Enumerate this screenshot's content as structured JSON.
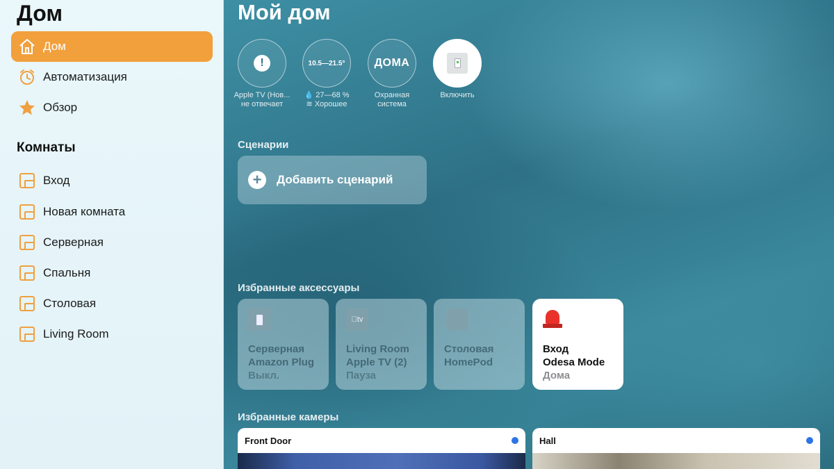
{
  "sidebar": {
    "title": "Дом",
    "nav": [
      {
        "label": "Дом",
        "icon": "house-icon",
        "active": true
      },
      {
        "label": "Автоматизация",
        "icon": "clock-icon",
        "active": false
      },
      {
        "label": "Обзор",
        "icon": "star-icon",
        "active": false
      }
    ],
    "rooms_title": "Комнаты",
    "rooms": [
      "Вход",
      "Новая комната",
      "Серверная",
      "Спальня",
      "Столовая",
      "Living Room"
    ]
  },
  "main": {
    "title": "Мой дом",
    "status": [
      {
        "icon": "alert-icon",
        "caption_line1": "Apple TV (Нов...",
        "caption_line2": "не отвечает"
      },
      {
        "value": "10.5—21.5°",
        "caption_line1": "💧 27—68 %",
        "caption_line2": "≋ Хорошее"
      },
      {
        "value": "ДОМА",
        "caption_line1": "Охранная",
        "caption_line2": "система"
      },
      {
        "icon": "plug-icon",
        "caption_line1": "Включить",
        "caption_line2": ""
      }
    ],
    "scenes_label": "Сценарии",
    "add_scene_label": "Добавить сценарий",
    "favorites_label": "Избранные аксессуары",
    "accessories": [
      {
        "name_line1": "Серверная",
        "name_line2": "Amazon Plug",
        "state": "Выкл.",
        "icon": "plug-icon",
        "on": false
      },
      {
        "name_line1": "Living Room",
        "name_line2": "Apple TV (2)",
        "state": "Пауза",
        "icon": "apple-tv-icon",
        "icon_text": "tv",
        "on": false
      },
      {
        "name_line1": "Столовая",
        "name_line2": "HomePod",
        "state": "",
        "icon": "homepod-icon",
        "on": false
      },
      {
        "name_line1": "Вход",
        "name_line2": "Odesa Mode",
        "state": "Дома",
        "icon": "siren-icon",
        "on": true
      }
    ],
    "cameras_label": "Избранные камеры",
    "cameras": [
      {
        "name": "Front Door"
      },
      {
        "name": "Hall"
      }
    ]
  },
  "colors": {
    "accent": "#f2a03c",
    "camera_dot": "#2f74e6"
  }
}
